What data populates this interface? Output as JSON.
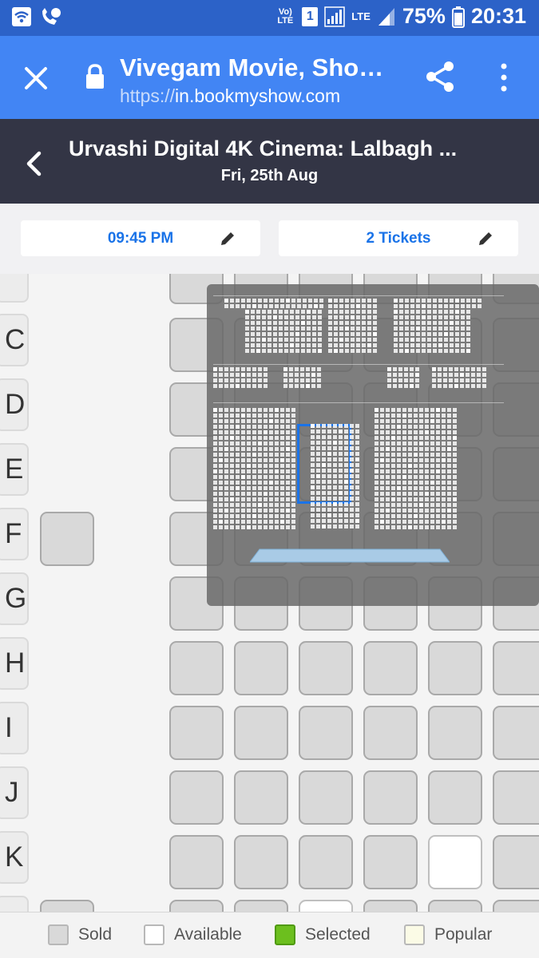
{
  "status_bar": {
    "network_label": "Vo) LTE",
    "sim_label": "1",
    "lte_label": "LTE",
    "battery": "75%",
    "time": "20:31"
  },
  "browser": {
    "page_title": "Vivegam Movie, Sho…",
    "url_scheme": "https://",
    "url_host": "in.bookmyshow.com"
  },
  "theatre": {
    "name": "Urvashi Digital 4K Cinema: Lalbagh ...",
    "date": "Fri, 25th Aug"
  },
  "selection": {
    "showtime": "09:45 PM",
    "tickets": "2 Tickets"
  },
  "rows": [
    "C",
    "D",
    "E",
    "F",
    "G",
    "H",
    "I",
    "J",
    "K"
  ],
  "legend": {
    "sold": "Sold",
    "available": "Available",
    "selected": "Selected",
    "popular": "Popular"
  },
  "colors": {
    "status_bar": "#2c62c8",
    "url_bar": "#4285f4",
    "header": "#333545",
    "accent": "#1a73e8",
    "sold": "#d9d9d9",
    "available": "#ffffff",
    "selected": "#6cbf1e",
    "popular": "#fbfbe6"
  }
}
